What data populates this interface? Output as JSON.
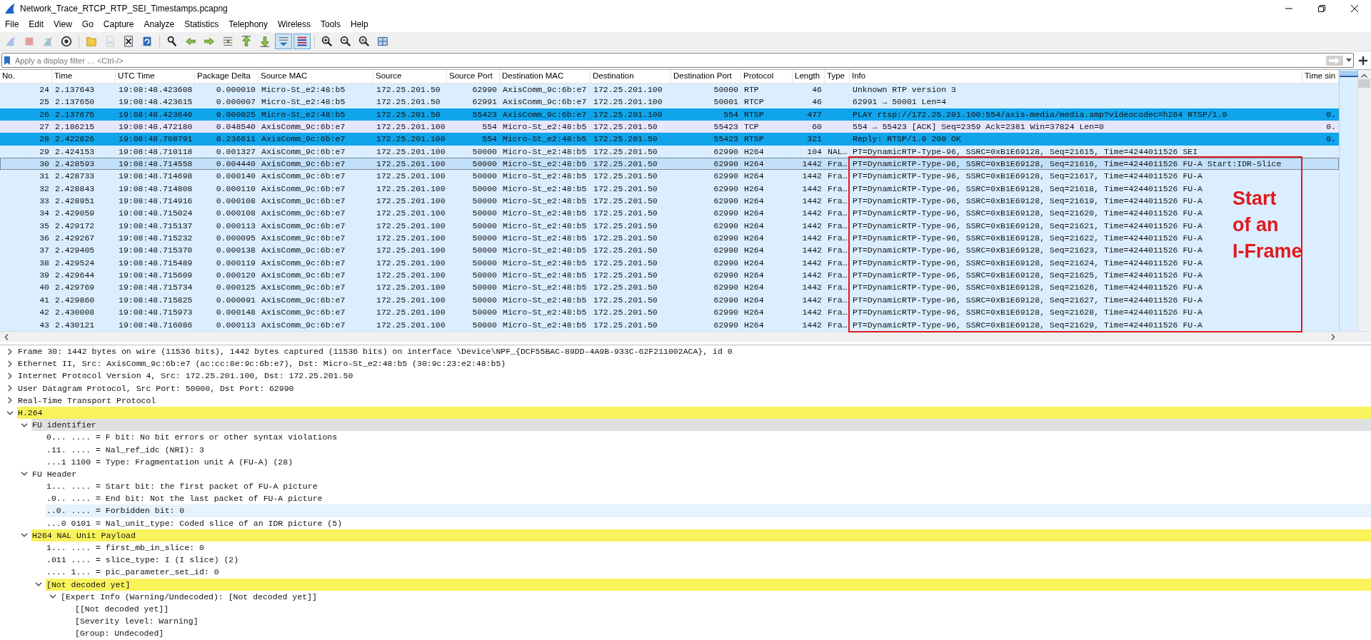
{
  "window": {
    "title": "Network_Trace_RTCP_RTP_SEI_Timestamps.pcapng"
  },
  "menu": [
    "File",
    "Edit",
    "View",
    "Go",
    "Capture",
    "Analyze",
    "Statistics",
    "Telephony",
    "Wireless",
    "Tools",
    "Help"
  ],
  "toolbar": {
    "groups": [
      [
        {
          "kind": "fin",
          "disabled": true,
          "pressed": false
        },
        {
          "kind": "stop",
          "disabled": true,
          "pressed": false
        },
        {
          "kind": "restart",
          "disabled": true,
          "pressed": false
        },
        {
          "kind": "options",
          "disabled": false,
          "pressed": false
        }
      ],
      [
        {
          "kind": "open",
          "disabled": false,
          "pressed": false
        },
        {
          "kind": "save",
          "disabled": true,
          "pressed": false
        },
        {
          "kind": "close",
          "disabled": false,
          "pressed": false
        },
        {
          "kind": "reload",
          "disabled": false,
          "pressed": false
        }
      ],
      [
        {
          "kind": "find",
          "disabled": false,
          "pressed": false
        },
        {
          "kind": "back",
          "disabled": false,
          "pressed": false
        },
        {
          "kind": "forward",
          "disabled": false,
          "pressed": false
        },
        {
          "kind": "goto",
          "disabled": false,
          "pressed": false
        },
        {
          "kind": "first",
          "disabled": false,
          "pressed": false
        },
        {
          "kind": "last",
          "disabled": false,
          "pressed": false
        },
        {
          "kind": "autoscroll",
          "disabled": false,
          "pressed": true
        },
        {
          "kind": "colorize",
          "disabled": false,
          "pressed": true
        }
      ],
      [
        {
          "kind": "zoom-in",
          "disabled": false,
          "pressed": false
        },
        {
          "kind": "zoom-out",
          "disabled": false,
          "pressed": false
        },
        {
          "kind": "zoom-reset",
          "disabled": false,
          "pressed": false
        },
        {
          "kind": "resize",
          "disabled": false,
          "pressed": false
        }
      ]
    ]
  },
  "filter": {
    "placeholder": "Apply a display filter … <Ctrl-/>"
  },
  "packet_list": {
    "columns": [
      "No.",
      "Time",
      "UTC Time",
      "Package Delta",
      "Source MAC",
      "Source",
      "Source Port",
      "Destination MAC",
      "Destination",
      "Destination Port",
      "Protocol",
      "Length",
      "Type",
      "Info",
      "Time sin"
    ],
    "rows": [
      {
        "no": "24",
        "time": "2.137643",
        "utc_time": "19:08:48.423608",
        "delta": "0.000010",
        "src_mac": "Micro-St_e2:48:b5",
        "src": "172.25.201.50",
        "src_port": "62990",
        "dst_mac": "AxisComm_9c:6b:e7",
        "dst": "172.25.201.100",
        "dst_port": "50000",
        "protocol": "RTP",
        "length": "46",
        "info": "Unknown RTP version 3",
        "color": "#daeeff",
        "selected": false
      },
      {
        "no": "25",
        "time": "2.137650",
        "utc_time": "19:08:48.423615",
        "delta": "0.000007",
        "src_mac": "Micro-St_e2:48:b5",
        "src": "172.25.201.50",
        "src_port": "62991",
        "dst_mac": "AxisComm_9c:6b:e7",
        "dst": "172.25.201.100",
        "dst_port": "50001",
        "protocol": "RTCP",
        "length": "46",
        "info": "62991 → 50001 Len=4",
        "color": "#daeeff",
        "selected": false
      },
      {
        "no": "26",
        "time": "2.137675",
        "utc_time": "19:08:48.423640",
        "delta": "0.000025",
        "src_mac": "Micro-St_e2:48:b5",
        "src": "172.25.201.50",
        "src_port": "55423",
        "dst_mac": "AxisComm_9c:6b:e7",
        "dst": "172.25.201.100",
        "dst_port": "554",
        "protocol": "RTSP",
        "length": "477",
        "info": "PLAY rtsp://172.25.201.100:554/axis-media/media.amp?videocodec=h264 RTSP/1.0",
        "time_since": "0.",
        "color": "#10a4ea",
        "selected": false
      },
      {
        "no": "27",
        "time": "2.186215",
        "utc_time": "19:08:48.472180",
        "delta": "0.048540",
        "src_mac": "AxisComm_9c:6b:e7",
        "src": "172.25.201.100",
        "src_port": "554",
        "dst_mac": "Micro-St_e2:48:b5",
        "dst": "172.25.201.50",
        "dst_port": "55423",
        "protocol": "TCP",
        "length": "60",
        "info": "554 → 55423 [ACK] Seq=2359 Ack=2381 Win=37824 Len=0",
        "time_since": "0.",
        "color": "#e7e6ff",
        "selected": false
      },
      {
        "no": "28",
        "time": "2.422826",
        "utc_time": "19:08:48.708791",
        "delta": "0.236611",
        "src_mac": "AxisComm_9c:6b:e7",
        "src": "172.25.201.100",
        "src_port": "554",
        "dst_mac": "Micro-St_e2:48:b5",
        "dst": "172.25.201.50",
        "dst_port": "55423",
        "protocol": "RTSP",
        "length": "321",
        "info": "Reply: RTSP/1.0 200 OK",
        "time_since": "0.",
        "color": "#10a4ea",
        "selected": false
      },
      {
        "no": "29",
        "time": "2.424153",
        "utc_time": "19:08:48.710118",
        "delta": "0.001327",
        "src_mac": "AxisComm_9c:6b:e7",
        "src": "172.25.201.100",
        "src_port": "50000",
        "dst_mac": "Micro-St_e2:48:b5",
        "dst": "172.25.201.50",
        "dst_port": "62990",
        "protocol": "H264",
        "length": "104",
        "type": "NAL…",
        "info": "PT=DynamicRTP-Type-96, SSRC=0xB1E69128, Seq=21615, Time=4244011526 SEI",
        "color": "#daeeff",
        "selected": false
      },
      {
        "no": "30",
        "time": "2.428593",
        "utc_time": "19:08:48.714558",
        "delta": "0.004440",
        "src_mac": "AxisComm_9c:6b:e7",
        "src": "172.25.201.100",
        "src_port": "50000",
        "dst_mac": "Micro-St_e2:48:b5",
        "dst": "172.25.201.50",
        "dst_port": "62990",
        "protocol": "H264",
        "length": "1442",
        "type": "Fra…",
        "info": "PT=DynamicRTP-Type-96, SSRC=0xB1E69128, Seq=21616, Time=4244011526 FU-A Start:IDR-Slice",
        "color": "#c2e0fa",
        "selected": true
      },
      {
        "no": "31",
        "time": "2.428733",
        "utc_time": "19:08:48.714698",
        "delta": "0.000140",
        "src_mac": "AxisComm_9c:6b:e7",
        "src": "172.25.201.100",
        "src_port": "50000",
        "dst_mac": "Micro-St_e2:48:b5",
        "dst": "172.25.201.50",
        "dst_port": "62990",
        "protocol": "H264",
        "length": "1442",
        "type": "Fra…",
        "info": "PT=DynamicRTP-Type-96, SSRC=0xB1E69128, Seq=21617, Time=4244011526 FU-A",
        "color": "#daeeff",
        "selected": false
      },
      {
        "no": "32",
        "time": "2.428843",
        "utc_time": "19:08:48.714808",
        "delta": "0.000110",
        "src_mac": "AxisComm_9c:6b:e7",
        "src": "172.25.201.100",
        "src_port": "50000",
        "dst_mac": "Micro-St_e2:48:b5",
        "dst": "172.25.201.50",
        "dst_port": "62990",
        "protocol": "H264",
        "length": "1442",
        "type": "Fra…",
        "info": "PT=DynamicRTP-Type-96, SSRC=0xB1E69128, Seq=21618, Time=4244011526 FU-A",
        "color": "#daeeff",
        "selected": false
      },
      {
        "no": "33",
        "time": "2.428951",
        "utc_time": "19:08:48.714916",
        "delta": "0.000108",
        "src_mac": "AxisComm_9c:6b:e7",
        "src": "172.25.201.100",
        "src_port": "50000",
        "dst_mac": "Micro-St_e2:48:b5",
        "dst": "172.25.201.50",
        "dst_port": "62990",
        "protocol": "H264",
        "length": "1442",
        "type": "Fra…",
        "info": "PT=DynamicRTP-Type-96, SSRC=0xB1E69128, Seq=21619, Time=4244011526 FU-A",
        "color": "#daeeff",
        "selected": false
      },
      {
        "no": "34",
        "time": "2.429059",
        "utc_time": "19:08:48.715024",
        "delta": "0.000108",
        "src_mac": "AxisComm_9c:6b:e7",
        "src": "172.25.201.100",
        "src_port": "50000",
        "dst_mac": "Micro-St_e2:48:b5",
        "dst": "172.25.201.50",
        "dst_port": "62990",
        "protocol": "H264",
        "length": "1442",
        "type": "Fra…",
        "info": "PT=DynamicRTP-Type-96, SSRC=0xB1E69128, Seq=21620, Time=4244011526 FU-A",
        "color": "#daeeff",
        "selected": false
      },
      {
        "no": "35",
        "time": "2.429172",
        "utc_time": "19:08:48.715137",
        "delta": "0.000113",
        "src_mac": "AxisComm_9c:6b:e7",
        "src": "172.25.201.100",
        "src_port": "50000",
        "dst_mac": "Micro-St_e2:48:b5",
        "dst": "172.25.201.50",
        "dst_port": "62990",
        "protocol": "H264",
        "length": "1442",
        "type": "Fra…",
        "info": "PT=DynamicRTP-Type-96, SSRC=0xB1E69128, Seq=21621, Time=4244011526 FU-A",
        "color": "#daeeff",
        "selected": false
      },
      {
        "no": "36",
        "time": "2.429267",
        "utc_time": "19:08:48.715232",
        "delta": "0.000095",
        "src_mac": "AxisComm_9c:6b:e7",
        "src": "172.25.201.100",
        "src_port": "50000",
        "dst_mac": "Micro-St_e2:48:b5",
        "dst": "172.25.201.50",
        "dst_port": "62990",
        "protocol": "H264",
        "length": "1442",
        "type": "Fra…",
        "info": "PT=DynamicRTP-Type-96, SSRC=0xB1E69128, Seq=21622, Time=4244011526 FU-A",
        "color": "#daeeff",
        "selected": false
      },
      {
        "no": "37",
        "time": "2.429405",
        "utc_time": "19:08:48.715370",
        "delta": "0.000138",
        "src_mac": "AxisComm_9c:6b:e7",
        "src": "172.25.201.100",
        "src_port": "50000",
        "dst_mac": "Micro-St_e2:48:b5",
        "dst": "172.25.201.50",
        "dst_port": "62990",
        "protocol": "H264",
        "length": "1442",
        "type": "Fra…",
        "info": "PT=DynamicRTP-Type-96, SSRC=0xB1E69128, Seq=21623, Time=4244011526 FU-A",
        "color": "#daeeff",
        "selected": false
      },
      {
        "no": "38",
        "time": "2.429524",
        "utc_time": "19:08:48.715489",
        "delta": "0.000119",
        "src_mac": "AxisComm_9c:6b:e7",
        "src": "172.25.201.100",
        "src_port": "50000",
        "dst_mac": "Micro-St_e2:48:b5",
        "dst": "172.25.201.50",
        "dst_port": "62990",
        "protocol": "H264",
        "length": "1442",
        "type": "Fra…",
        "info": "PT=DynamicRTP-Type-96, SSRC=0xB1E69128, Seq=21624, Time=4244011526 FU-A",
        "color": "#daeeff",
        "selected": false
      },
      {
        "no": "39",
        "time": "2.429644",
        "utc_time": "19:08:48.715609",
        "delta": "0.000120",
        "src_mac": "AxisComm_9c:6b:e7",
        "src": "172.25.201.100",
        "src_port": "50000",
        "dst_mac": "Micro-St_e2:48:b5",
        "dst": "172.25.201.50",
        "dst_port": "62990",
        "protocol": "H264",
        "length": "1442",
        "type": "Fra…",
        "info": "PT=DynamicRTP-Type-96, SSRC=0xB1E69128, Seq=21625, Time=4244011526 FU-A",
        "color": "#daeeff",
        "selected": false
      },
      {
        "no": "40",
        "time": "2.429769",
        "utc_time": "19:08:48.715734",
        "delta": "0.000125",
        "src_mac": "AxisComm_9c:6b:e7",
        "src": "172.25.201.100",
        "src_port": "50000",
        "dst_mac": "Micro-St_e2:48:b5",
        "dst": "172.25.201.50",
        "dst_port": "62990",
        "protocol": "H264",
        "length": "1442",
        "type": "Fra…",
        "info": "PT=DynamicRTP-Type-96, SSRC=0xB1E69128, Seq=21626, Time=4244011526 FU-A",
        "color": "#daeeff",
        "selected": false
      },
      {
        "no": "41",
        "time": "2.429860",
        "utc_time": "19:08:48.715825",
        "delta": "0.000091",
        "src_mac": "AxisComm_9c:6b:e7",
        "src": "172.25.201.100",
        "src_port": "50000",
        "dst_mac": "Micro-St_e2:48:b5",
        "dst": "172.25.201.50",
        "dst_port": "62990",
        "protocol": "H264",
        "length": "1442",
        "type": "Fra…",
        "info": "PT=DynamicRTP-Type-96, SSRC=0xB1E69128, Seq=21627, Time=4244011526 FU-A",
        "color": "#daeeff",
        "selected": false
      },
      {
        "no": "42",
        "time": "2.430008",
        "utc_time": "19:08:48.715973",
        "delta": "0.000148",
        "src_mac": "AxisComm_9c:6b:e7",
        "src": "172.25.201.100",
        "src_port": "50000",
        "dst_mac": "Micro-St_e2:48:b5",
        "dst": "172.25.201.50",
        "dst_port": "62990",
        "protocol": "H264",
        "length": "1442",
        "type": "Fra…",
        "info": "PT=DynamicRTP-Type-96, SSRC=0xB1E69128, Seq=21628, Time=4244011526 FU-A",
        "color": "#daeeff",
        "selected": false
      },
      {
        "no": "43",
        "time": "2.430121",
        "utc_time": "19:08:48.716086",
        "delta": "0.000113",
        "src_mac": "AxisComm_9c:6b:e7",
        "src": "172.25.201.100",
        "src_port": "50000",
        "dst_mac": "Micro-St_e2:48:b5",
        "dst": "172.25.201.50",
        "dst_port": "62990",
        "protocol": "H264",
        "length": "1442",
        "type": "Fra…",
        "info": "PT=DynamicRTP-Type-96, SSRC=0xB1E69128, Seq=21629, Time=4244011526 FU-A",
        "color": "#daeeff",
        "selected": false
      }
    ],
    "annotation": {
      "lines": [
        "Start",
        "of an",
        "I-Frame"
      ]
    }
  },
  "details": [
    {
      "text": "Frame 30: 1442 bytes on wire (11536 bits), 1442 bytes captured (11536 bits) on interface \\Device\\NPF_{DCF55BAC-89DD-4A9B-933C-62F211002ACA}, id 0",
      "expanded": false
    },
    {
      "text": "Ethernet II, Src: AxisComm_9c:6b:e7 (ac:cc:8e:9c:6b:e7), Dst: Micro-St_e2:48:b5 (30:9c:23:e2:48:b5)",
      "expanded": false
    },
    {
      "text": "Internet Protocol Version 4, Src: 172.25.201.100, Dst: 172.25.201.50",
      "expanded": false
    },
    {
      "text": "User Datagram Protocol, Src Port: 50000, Dst Port: 62990",
      "expanded": false
    },
    {
      "text": "Real-Time Transport Protocol",
      "expanded": false
    },
    {
      "text": "H.264",
      "expanded": true,
      "color": "#f8f35c",
      "children": [
        {
          "text": "FU identifier",
          "expanded": true,
          "color": "#e0e0e0",
          "children": [
            {
              "text": "0... .... = F bit: No bit errors or other syntax violations"
            },
            {
              "text": ".11. .... = Nal_ref_idc (NRI): 3"
            },
            {
              "text": "...1 1100 = Type: Fragmentation unit A (FU-A) (28)"
            }
          ]
        },
        {
          "text": "FU Header",
          "expanded": true,
          "children": [
            {
              "text": "1... .... = Start bit: the first packet of FU-A picture"
            },
            {
              "text": ".0.. .... = End bit: Not the last packet of FU-A picture"
            },
            {
              "text": "..0. .... = Forbidden bit: 0",
              "color": "#e6f3fc"
            },
            {
              "text": "...0 0101 = Nal_unit_type: Coded slice of an IDR picture (5)"
            }
          ]
        },
        {
          "text": "H264 NAL Unit Payload",
          "expanded": true,
          "color": "#f8f35c",
          "children": [
            {
              "text": "1... .... = first_mb_in_slice: 0"
            },
            {
              "text": ".011 .... = slice_type: I (I slice) (2)"
            },
            {
              "text": ".... 1... = pic_parameter_set_id: 0"
            },
            {
              "text": "[Not decoded yet]",
              "expanded": true,
              "color": "#f8f35c",
              "children": [
                {
                  "text": "[Expert Info (Warning/Undecoded): [Not decoded yet]]",
                  "expanded": true,
                  "children": [
                    {
                      "text": "[[Not decoded yet]]"
                    },
                    {
                      "text": "[Severity level: Warning]"
                    },
                    {
                      "text": "[Group: Undecoded]"
                    }
                  ]
                }
              ]
            }
          ]
        }
      ]
    }
  ]
}
